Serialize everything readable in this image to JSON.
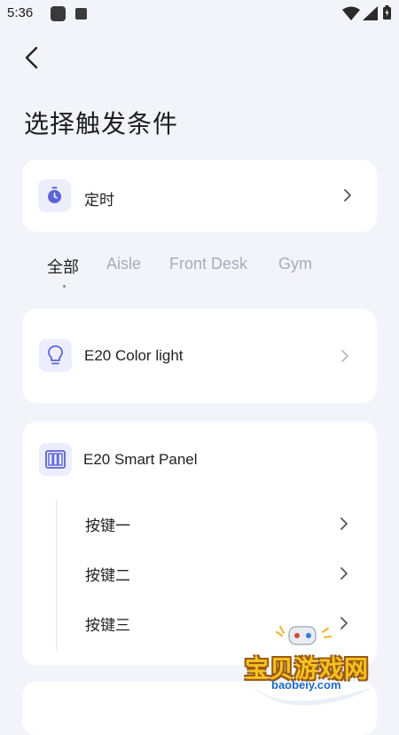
{
  "status_bar": {
    "time": "5:36"
  },
  "page": {
    "title": "选择触发条件"
  },
  "timer_card": {
    "label": "定时"
  },
  "tabs": [
    {
      "label": "全部",
      "active": true
    },
    {
      "label": "Aisle",
      "active": false
    },
    {
      "label": "Front Desk",
      "active": false
    },
    {
      "label": "Gym",
      "active": false
    }
  ],
  "devices": {
    "light": {
      "label": "E20 Color light"
    },
    "panel": {
      "label": "E20 Smart Panel",
      "buttons": [
        {
          "label": "按键一"
        },
        {
          "label": "按键二"
        },
        {
          "label": "按键三"
        }
      ]
    }
  },
  "watermark": {
    "title": "宝贝游戏网",
    "url": "baobeiy.com"
  },
  "colors": {
    "accent": "#5b63d8",
    "background": "#f2f4fa",
    "icon_bg": "#eceefc",
    "inactive_tab": "#a8acb6"
  }
}
